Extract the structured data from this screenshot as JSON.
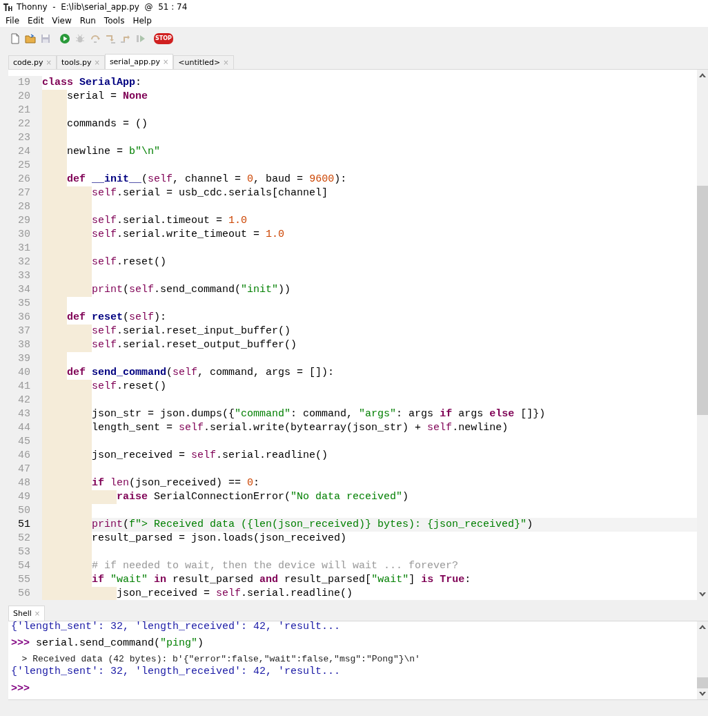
{
  "window": {
    "title": "Thonny  -  E:\\lib\\serial_app.py  @  51 : 74"
  },
  "menu": [
    "File",
    "Edit",
    "View",
    "Run",
    "Tools",
    "Help"
  ],
  "toolbar": [
    {
      "disabled": false
    },
    {
      "disabled": false
    },
    {
      "disabled": true
    },
    {
      "disabled": false
    },
    {
      "disabled": true
    },
    {
      "disabled": true
    },
    {
      "disabled": true
    },
    {
      "disabled": true
    },
    {
      "disabled": true
    },
    {
      "disabled": false,
      "label": "STOP"
    }
  ],
  "tabs": [
    {
      "label": "code.py",
      "close": "×",
      "selected": false
    },
    {
      "label": "tools.py",
      "close": "×",
      "selected": false
    },
    {
      "label": "serial_app.py",
      "close": "×",
      "selected": true
    },
    {
      "label": "<untitled>",
      "close": "×",
      "selected": false
    }
  ],
  "editor": {
    "lines": [
      {
        "number": "19",
        "current": false,
        "tokens": [
          {
            "kind": "kw",
            "text": "class"
          },
          {
            "kind": "name",
            "text": " SerialApp"
          },
          {
            "kind": "text",
            "text": ":"
          }
        ],
        "children": [
          {
            "number": "20",
            "current": false,
            "tokens": [
              {
                "kind": "text",
                "text": "serial = "
              },
              {
                "kind": "kw",
                "text": "None"
              }
            ]
          },
          {
            "number": "21",
            "current": false
          },
          {
            "number": "22",
            "current": false,
            "tokens": [
              {
                "kind": "text",
                "text": "commands = ()"
              }
            ]
          },
          {
            "number": "23",
            "current": false
          },
          {
            "number": "24",
            "current": false,
            "tokens": [
              {
                "kind": "text",
                "text": "newline = "
              },
              {
                "kind": "str",
                "text": "b\"\\n\""
              }
            ]
          },
          {
            "number": "25",
            "current": false
          },
          {
            "number": "26",
            "current": false,
            "tokens": [
              {
                "kind": "kw",
                "text": "def"
              },
              {
                "kind": "name",
                "text": " __init__"
              },
              {
                "kind": "text",
                "text": "("
              },
              {
                "kind": "builtin",
                "text": "self"
              },
              {
                "kind": "text",
                "text": ", channel = "
              },
              {
                "kind": "num",
                "text": "0"
              },
              {
                "kind": "text",
                "text": ", baud = "
              },
              {
                "kind": "num",
                "text": "9600"
              },
              {
                "kind": "text",
                "text": "):"
              }
            ],
            "children": [
              {
                "number": "27",
                "current": false,
                "tokens": [
                  {
                    "kind": "builtin",
                    "text": "self"
                  },
                  {
                    "kind": "text",
                    "text": ".serial = usb_cdc.serials[channel]"
                  }
                ]
              },
              {
                "number": "28",
                "current": false
              },
              {
                "number": "29",
                "current": false,
                "tokens": [
                  {
                    "kind": "builtin",
                    "text": "self"
                  },
                  {
                    "kind": "text",
                    "text": ".serial.timeout = "
                  },
                  {
                    "kind": "num",
                    "text": "1.0"
                  }
                ]
              },
              {
                "number": "30",
                "current": false,
                "tokens": [
                  {
                    "kind": "builtin",
                    "text": "self"
                  },
                  {
                    "kind": "text",
                    "text": ".serial.write_timeout = "
                  },
                  {
                    "kind": "num",
                    "text": "1.0"
                  }
                ]
              },
              {
                "number": "31",
                "current": false
              },
              {
                "number": "32",
                "current": false,
                "tokens": [
                  {
                    "kind": "builtin",
                    "text": "self"
                  },
                  {
                    "kind": "text",
                    "text": ".reset()"
                  }
                ]
              },
              {
                "number": "33",
                "current": false
              },
              {
                "number": "34",
                "current": false,
                "tokens": [
                  {
                    "kind": "builtin",
                    "text": "print"
                  },
                  {
                    "kind": "text",
                    "text": "("
                  },
                  {
                    "kind": "builtin",
                    "text": "self"
                  },
                  {
                    "kind": "text",
                    "text": ".send_command("
                  },
                  {
                    "kind": "str",
                    "text": "\"init\""
                  },
                  {
                    "kind": "text",
                    "text": "))"
                  }
                ]
              }
            ]
          },
          {
            "number": "35",
            "current": false
          },
          {
            "number": "36",
            "current": false,
            "tokens": [
              {
                "kind": "kw",
                "text": "def"
              },
              {
                "kind": "name",
                "text": " reset"
              },
              {
                "kind": "text",
                "text": "("
              },
              {
                "kind": "builtin",
                "text": "self"
              },
              {
                "kind": "text",
                "text": "):"
              }
            ],
            "children": [
              {
                "number": "37",
                "current": false,
                "tokens": [
                  {
                    "kind": "builtin",
                    "text": "self"
                  },
                  {
                    "kind": "text",
                    "text": ".serial.reset_input_buffer()"
                  }
                ]
              },
              {
                "number": "38",
                "current": false,
                "tokens": [
                  {
                    "kind": "builtin",
                    "text": "self"
                  },
                  {
                    "kind": "text",
                    "text": ".serial.reset_output_buffer()"
                  }
                ]
              }
            ]
          },
          {
            "number": "39",
            "current": false
          },
          {
            "number": "40",
            "current": false,
            "tokens": [
              {
                "kind": "kw",
                "text": "def"
              },
              {
                "kind": "name",
                "text": " send_command"
              },
              {
                "kind": "text",
                "text": "("
              },
              {
                "kind": "builtin",
                "text": "self"
              },
              {
                "kind": "text",
                "text": ", command, args = []):"
              }
            ],
            "children": [
              {
                "number": "41",
                "current": false,
                "tokens": [
                  {
                    "kind": "builtin",
                    "text": "self"
                  },
                  {
                    "kind": "text",
                    "text": ".reset()"
                  }
                ]
              },
              {
                "number": "42",
                "current": false
              },
              {
                "number": "43",
                "current": false,
                "tokens": [
                  {
                    "kind": "text",
                    "text": "json_str = json.dumps({"
                  },
                  {
                    "kind": "str",
                    "text": "\"command\""
                  },
                  {
                    "kind": "text",
                    "text": ": command, "
                  },
                  {
                    "kind": "str",
                    "text": "\"args\""
                  },
                  {
                    "kind": "text",
                    "text": ": args "
                  },
                  {
                    "kind": "kw",
                    "text": "if"
                  },
                  {
                    "kind": "text",
                    "text": " args "
                  },
                  {
                    "kind": "kw",
                    "text": "else"
                  },
                  {
                    "kind": "text",
                    "text": " []})"
                  }
                ]
              },
              {
                "number": "44",
                "current": false,
                "tokens": [
                  {
                    "kind": "text",
                    "text": "length_sent = "
                  },
                  {
                    "kind": "builtin",
                    "text": "self"
                  },
                  {
                    "kind": "text",
                    "text": ".serial.write(bytearray(json_str) + "
                  },
                  {
                    "kind": "builtin",
                    "text": "self"
                  },
                  {
                    "kind": "text",
                    "text": ".newline)"
                  }
                ]
              },
              {
                "number": "45",
                "current": false
              },
              {
                "number": "46",
                "current": false,
                "tokens": [
                  {
                    "kind": "text",
                    "text": "json_received = "
                  },
                  {
                    "kind": "builtin",
                    "text": "self"
                  },
                  {
                    "kind": "text",
                    "text": ".serial.readline()"
                  }
                ]
              },
              {
                "number": "47",
                "current": false
              },
              {
                "number": "48",
                "current": false,
                "tokens": [
                  {
                    "kind": "kw",
                    "text": "if"
                  },
                  {
                    "kind": "builtin",
                    "text": " len"
                  },
                  {
                    "kind": "text",
                    "text": "(json_received) == "
                  },
                  {
                    "kind": "num",
                    "text": "0"
                  },
                  {
                    "kind": "text",
                    "text": ":"
                  }
                ],
                "children": [
                  {
                    "number": "49",
                    "current": false,
                    "tokens": [
                      {
                        "kind": "kw",
                        "text": "raise"
                      },
                      {
                        "kind": "text",
                        "text": " SerialConnectionError("
                      },
                      {
                        "kind": "str",
                        "text": "\"No data received\""
                      },
                      {
                        "kind": "text",
                        "text": ")"
                      }
                    ]
                  }
                ]
              },
              {
                "number": "50",
                "current": false
              },
              {
                "number": "51",
                "current": true,
                "tokens": [
                  {
                    "kind": "builtin",
                    "text": "print"
                  },
                  {
                    "kind": "text",
                    "text": "("
                  },
                  {
                    "kind": "str",
                    "text": "f\"> Received data ({len(json_received)} bytes): {json_received}\""
                  },
                  {
                    "kind": "text",
                    "text": ")"
                  }
                ]
              },
              {
                "number": "52",
                "current": false,
                "tokens": [
                  {
                    "kind": "text",
                    "text": "result_parsed = json.loads(json_received)"
                  }
                ]
              },
              {
                "number": "53",
                "current": false
              },
              {
                "number": "54",
                "current": false,
                "tokens": [
                  {
                    "kind": "comment",
                    "text": "# if needed to wait, then the device will wait ... forever?"
                  }
                ]
              },
              {
                "number": "55",
                "current": false,
                "tokens": [
                  {
                    "kind": "kw",
                    "text": "if"
                  },
                  {
                    "kind": "str",
                    "text": " \"wait\""
                  },
                  {
                    "kind": "kw",
                    "text": " in"
                  },
                  {
                    "kind": "text",
                    "text": " result_parsed "
                  },
                  {
                    "kind": "kw",
                    "text": "and"
                  },
                  {
                    "kind": "text",
                    "text": " result_parsed["
                  },
                  {
                    "kind": "str",
                    "text": "\"wait\""
                  },
                  {
                    "kind": "text",
                    "text": "] "
                  },
                  {
                    "kind": "kw",
                    "text": "is"
                  },
                  {
                    "kind": "kw",
                    "text": " True"
                  },
                  {
                    "kind": "text",
                    "text": ":"
                  }
                ],
                "children": [
                  {
                    "number": "56",
                    "current": false,
                    "tokens": [
                      {
                        "kind": "text",
                        "text": "json_received = "
                      },
                      {
                        "kind": "builtin",
                        "text": "self"
                      },
                      {
                        "kind": "text",
                        "text": ".serial.readline()"
                      }
                    ]
                  }
                ]
              }
            ]
          }
        ]
      }
    ]
  },
  "shell": {
    "tab": {
      "label": "Shell",
      "close": "×",
      "selected": true
    },
    "lines": [
      {
        "kind": "result",
        "text": "{'length_sent': 32, 'length_received': 42, 'result..."
      },
      {
        "kind": "input",
        "prompt": ">>>",
        "tokens": [
          {
            "kind": "text",
            "text": "serial.send_command("
          },
          {
            "kind": "str",
            "text": "\"ping\""
          },
          {
            "kind": "text",
            "text": ")"
          }
        ]
      },
      {
        "kind": "output",
        "text": "  > Received data (42 bytes): b'{\"error\":false,\"wait\":false,\"msg\":\"Pong\"}\\n'"
      },
      {
        "kind": "result",
        "text": "{'length_sent': 32, 'length_received': 42, 'result..."
      },
      {
        "kind": "input",
        "prompt": ">>>"
      }
    ]
  }
}
